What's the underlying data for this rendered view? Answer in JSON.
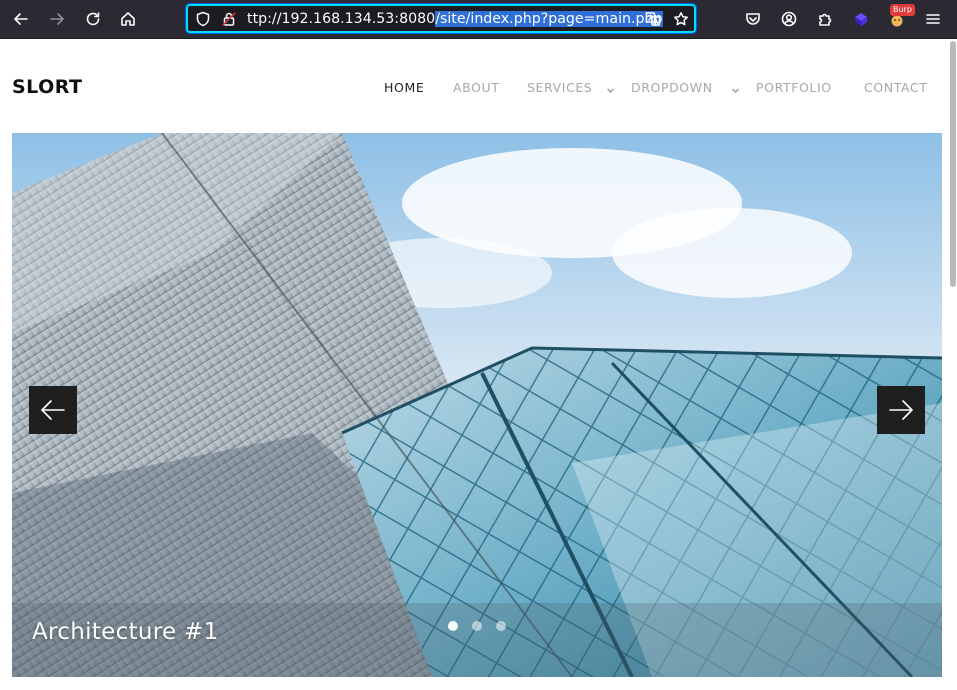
{
  "browser": {
    "url_plain": "ttp://192.168.134.53:8080",
    "url_selected": "/site/index.php?page=main.php",
    "extension_badge": "Burp",
    "icons": {
      "back": "arrow-left-icon",
      "forward": "arrow-right-icon",
      "reload": "reload-icon",
      "home": "home-icon",
      "shield": "shield-icon",
      "insecure": "insecure-lock-icon",
      "translate": "translate-icon",
      "bookmark": "star-icon",
      "pocket": "pocket-icon",
      "account": "account-icon",
      "extensions": "puzzle-icon",
      "menu": "hamburger-icon"
    }
  },
  "site": {
    "logo": "SLORT",
    "nav": [
      {
        "label": "HOME",
        "active": true
      },
      {
        "label": "ABOUT"
      },
      {
        "label": "SERVICES",
        "dropdown": true
      },
      {
        "label": "DROPDOWN",
        "dropdown": true
      },
      {
        "label": "PORTFOLIO"
      },
      {
        "label": "CONTACT"
      }
    ]
  },
  "slider": {
    "caption": "Architecture #1",
    "slide_count": 3,
    "active_slide": 1
  },
  "colors": {
    "toolbar_bg": "#2b2a33",
    "url_selection": "#2f6fd8",
    "nav_active": "#222222",
    "nav_inactive": "#a8a8a8",
    "arrow_bg": "#1f1f1f"
  }
}
